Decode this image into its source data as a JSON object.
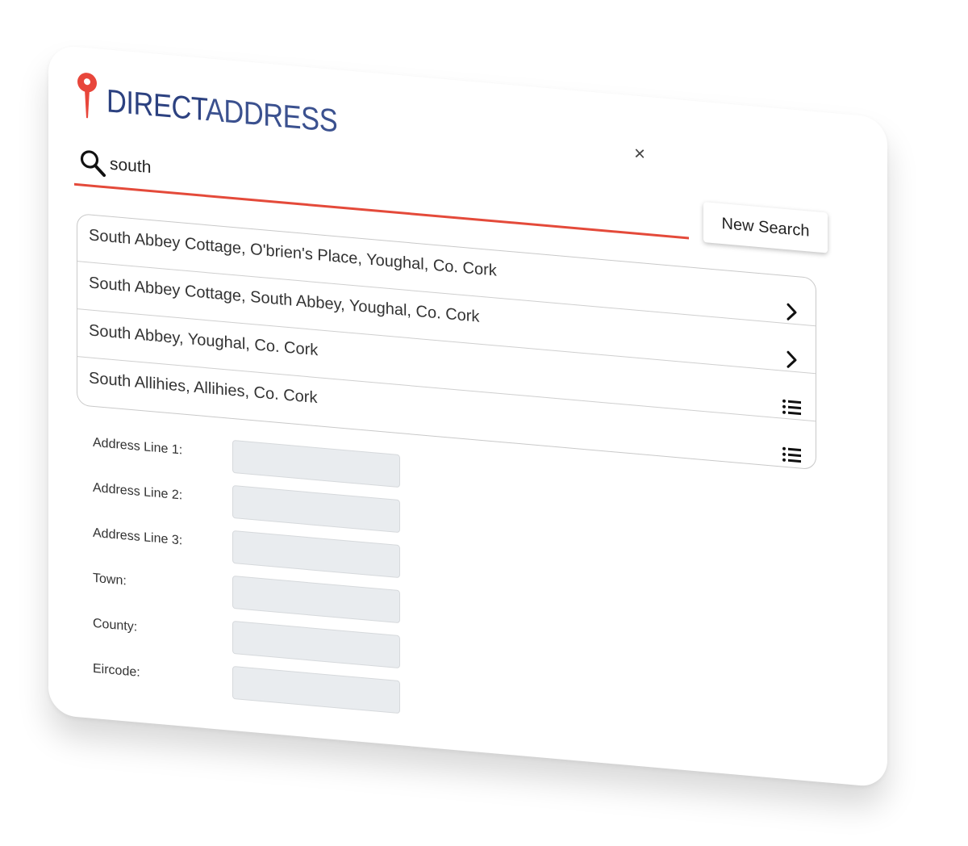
{
  "brand": {
    "part1": "DIRECT",
    "part2": "ADDRESS",
    "pin_color": "#e8463b",
    "text_color": "#2c4180"
  },
  "search": {
    "value": "south",
    "accent_color": "#e44a3a",
    "clear_glyph": "×"
  },
  "new_search_label": "New Search",
  "results": [
    {
      "text": "South Abbey Cottage, O'brien's Place, Youghal, Co. Cork",
      "icon": "chevron-right-icon"
    },
    {
      "text": "South Abbey Cottage, South Abbey, Youghal, Co. Cork",
      "icon": "chevron-right-icon"
    },
    {
      "text": "South Abbey, Youghal, Co. Cork",
      "icon": "list-icon"
    },
    {
      "text": "South Allihies, Allihies, Co. Cork",
      "icon": "list-icon"
    }
  ],
  "form": {
    "fields": [
      {
        "label": "Address Line 1:",
        "value": ""
      },
      {
        "label": "Address Line 2:",
        "value": ""
      },
      {
        "label": "Address Line 3:",
        "value": ""
      },
      {
        "label": "Town:",
        "value": ""
      },
      {
        "label": "County:",
        "value": ""
      },
      {
        "label": "Eircode:",
        "value": ""
      }
    ]
  }
}
